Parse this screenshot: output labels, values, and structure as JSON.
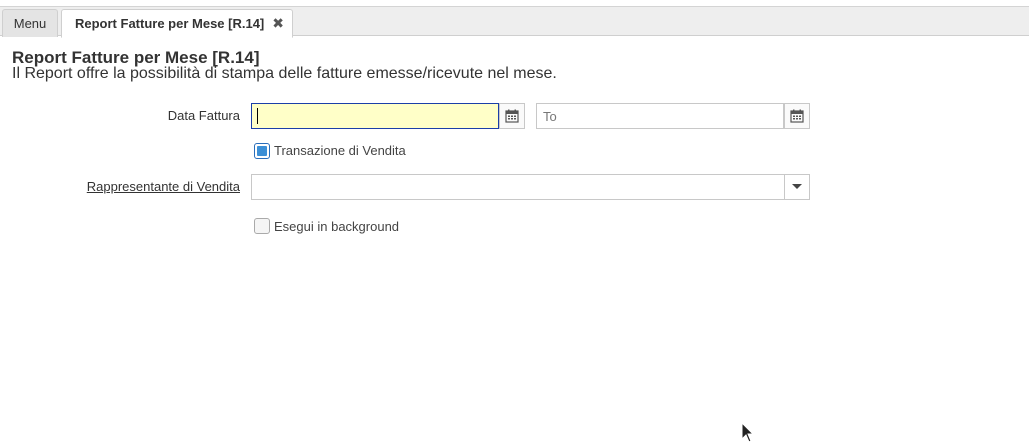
{
  "tabs": {
    "menu_label": "Menu",
    "active_label": "Report Fatture per Mese [R.14]",
    "close_glyph": "✖"
  },
  "header": {
    "title": "Report Fatture per Mese [R.14]",
    "description": "Il Report offre la possibilità di stampa delle fatture emesse/ricevute nel mese."
  },
  "form": {
    "data_fattura_label": "Data Fattura",
    "data_fattura_from_value": "",
    "data_fattura_to_placeholder": "To",
    "transazione_vendita_label": "Transazione di Vendita",
    "transazione_vendita_checked": true,
    "rappresentante_label": "Rappresentante di Vendita",
    "rappresentante_value": "",
    "esegui_background_label": "Esegui in background",
    "esegui_background_checked": false
  },
  "icons": {
    "calendar": "calendar-icon",
    "dropdown": "chevron-down-icon",
    "close": "close-icon"
  },
  "colors": {
    "focused_field_bg": "#ffffc8",
    "focused_field_border": "#1b3fa8",
    "checkbox_accent": "#3c8fd6"
  }
}
